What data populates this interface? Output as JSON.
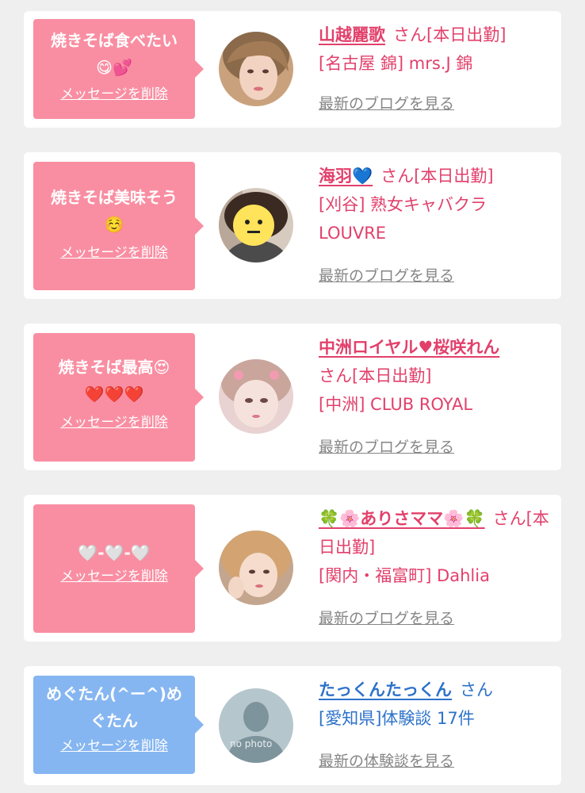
{
  "cards": [
    {
      "message": "焼きそば食べたい\n😋💕",
      "delete_label": "メッセージを削除",
      "name": "山越麗歌",
      "san": "さん[本日出勤]",
      "shop": "[名古屋 錦] mrs.J 錦",
      "link": "最新のブログを見る"
    },
    {
      "message": "焼きそば美味そう\n☺️",
      "delete_label": "メッセージを削除",
      "name": "海羽💙",
      "san": "さん[本日出勤]",
      "shop": "[刈谷] 熟女キャバクラ LOUVRE",
      "link": "最新のブログを見る"
    },
    {
      "message": "焼きそば最高😍\n❤️❤️❤️",
      "delete_label": "メッセージを削除",
      "name": "中洲ロイヤル♥桜咲れん",
      "san": "さん[本日出勤]",
      "shop": "[中洲] CLUB ROYAL",
      "link": "最新のブログを見る"
    },
    {
      "message": "🤍-🤍-🤍",
      "delete_label": "メッセージを削除",
      "name": "🍀🌸ありさママ🌸🍀",
      "san": "さん[本日出勤]",
      "shop": "[関内・福富町] Dahlia",
      "link": "最新のブログを見る"
    },
    {
      "message": "めぐたん(^ー^)めぐたん",
      "delete_label": "メッセージを削除",
      "name": "たっくんたっくん",
      "san": "さん",
      "shop": "[愛知県]体験談 17件",
      "link": "最新の体験談を見る",
      "avatar_text": "no photo"
    }
  ],
  "colors": {
    "pink_bubble": "#f98ea2",
    "blue_bubble": "#86b6f1",
    "pink_text": "#e2406b",
    "blue_text": "#2d72c9",
    "gray_link": "#868686"
  }
}
